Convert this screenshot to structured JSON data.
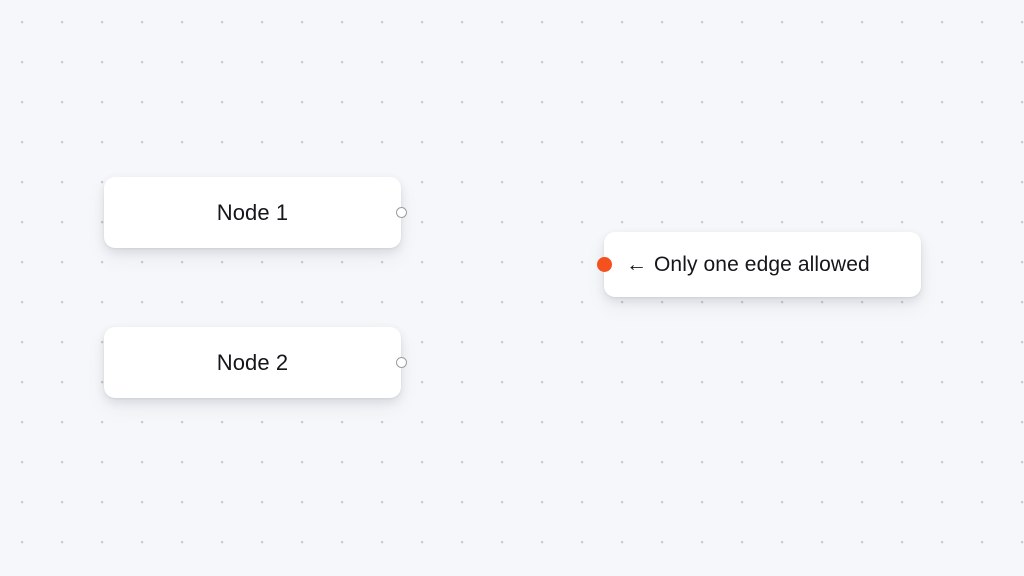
{
  "canvas": {
    "background_color": "#f5f7fa",
    "grid_dot_color": "#c5cad3",
    "grid_spacing": "40"
  },
  "nodes": [
    {
      "id": "node-1",
      "label": "Node 1",
      "handle": {
        "name": "source-handle",
        "type": "source",
        "style": "hollow",
        "color": "#9a9da3"
      }
    },
    {
      "id": "node-2",
      "label": "Node 2",
      "handle": {
        "name": "source-handle",
        "type": "source",
        "style": "hollow",
        "color": "#9a9da3"
      }
    }
  ],
  "note_node": {
    "id": "node-note",
    "arrow": "←",
    "label": "Only one edge allowed",
    "handle": {
      "name": "target-handle",
      "type": "target",
      "style": "filled",
      "color": "#f4511e"
    }
  }
}
